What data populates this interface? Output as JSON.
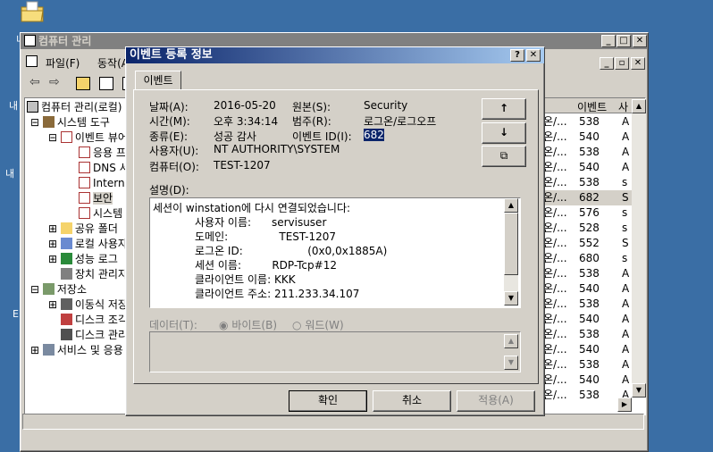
{
  "desktop": {
    "folder_icon": "folder-icon"
  },
  "mmc": {
    "title": "컴퓨터 관리",
    "menu": [
      "파일(F)",
      "동작(A)"
    ],
    "tree": [
      {
        "label": "컴퓨터 관리(로컬)"
      },
      {
        "label": "시스템 도구"
      },
      {
        "label": "이벤트 뷰어"
      },
      {
        "label": "응용 프로그램"
      },
      {
        "label": "DNS 서버"
      },
      {
        "label": "Internet Explorer"
      },
      {
        "label": "보안"
      },
      {
        "label": "시스템"
      },
      {
        "label": "공유 폴더"
      },
      {
        "label": "로컬 사용자"
      },
      {
        "label": "성능 로그"
      },
      {
        "label": "장치 관리자"
      },
      {
        "label": "저장소"
      },
      {
        "label": "이동식 저장소"
      },
      {
        "label": "디스크 조각 모음"
      },
      {
        "label": "디스크 관리"
      },
      {
        "label": "서비스 및 응용 프로그램"
      }
    ],
    "list_header": {
      "col1": "이벤트",
      "col2": "사"
    },
    "list_rows": [
      {
        "a": "온/...",
        "id": "538",
        "u": "A"
      },
      {
        "a": "온/...",
        "id": "540",
        "u": "A"
      },
      {
        "a": "온/...",
        "id": "538",
        "u": "A"
      },
      {
        "a": "온/...",
        "id": "540",
        "u": "A"
      },
      {
        "a": "온/...",
        "id": "538",
        "u": "s"
      },
      {
        "a": "온/...",
        "id": "682",
        "u": "S"
      },
      {
        "a": "온/...",
        "id": "576",
        "u": "s"
      },
      {
        "a": "온/...",
        "id": "528",
        "u": "s"
      },
      {
        "a": "온/...",
        "id": "552",
        "u": "S"
      },
      {
        "a": "온/...",
        "id": "680",
        "u": "s"
      },
      {
        "a": "온/...",
        "id": "538",
        "u": "A"
      },
      {
        "a": "온/...",
        "id": "540",
        "u": "A"
      },
      {
        "a": "온/...",
        "id": "538",
        "u": "A"
      },
      {
        "a": "온/...",
        "id": "540",
        "u": "A"
      },
      {
        "a": "온/...",
        "id": "538",
        "u": "A"
      },
      {
        "a": "온/...",
        "id": "540",
        "u": "A"
      },
      {
        "a": "온/...",
        "id": "538",
        "u": "A"
      },
      {
        "a": "온/...",
        "id": "540",
        "u": "A"
      },
      {
        "a": "온/...",
        "id": "538",
        "u": "A"
      }
    ]
  },
  "dialog": {
    "title": "이벤트 등록 정보",
    "tab": "이벤트",
    "date_label": "날짜(A):",
    "date": "2016-05-20",
    "time_label": "시간(M):",
    "time": "오후 3:34:14",
    "type_label": "종류(E):",
    "type": "성공 감사",
    "user_label": "사용자(U):",
    "user": "NT AUTHORITY\\SYSTEM",
    "computer_label": "컴퓨터(O):",
    "computer": "TEST-1207",
    "source_label": "원본(S):",
    "source": "Security",
    "category_label": "범주(R):",
    "category": "로그온/로그오프",
    "eventid_label": "이벤트 ID(I):",
    "eventid": "682",
    "desc_label": "설명(D):",
    "desc_lines": [
      "세션이 winstation에 다시 연결되었습니다:",
      "사용자 이름:      servisuser",
      "도메인:               TEST-1207",
      "로그온 ID:                   (0x0,0x1885A)",
      "세션 이름:         RDP-Tcp#12",
      "클라이언트 이름: KKK",
      "클라이언트 주소: 211.233.34.107"
    ],
    "data_label": "데이터(T):",
    "radio_bytes": "바이트(B)",
    "radio_words": "워드(W)",
    "ok": "확인",
    "cancel": "취소",
    "apply": "적용(A)"
  }
}
